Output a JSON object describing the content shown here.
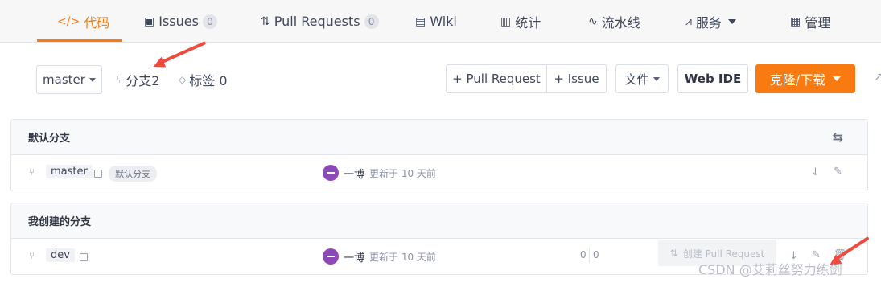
{
  "nav": {
    "tabs": [
      {
        "icon": "</>",
        "label": "代码",
        "active": true
      },
      {
        "icon": "▣",
        "label": "Issues",
        "count": "0"
      },
      {
        "icon": "⇅",
        "label": "Pull Requests",
        "count": "0"
      },
      {
        "icon": "▤",
        "label": "Wiki"
      },
      {
        "icon": "▥",
        "label": "统计"
      },
      {
        "icon": "∿",
        "label": "流水线"
      },
      {
        "icon": "⩘",
        "label": "服务"
      },
      {
        "icon": "▦",
        "label": "管理"
      }
    ]
  },
  "toolbar": {
    "branch_select": "master",
    "branch_count_label": "分支2",
    "tag_count_label": "标签 0",
    "pull_request_button": "+ Pull Request",
    "issue_button": "+ Issue",
    "file_button": "文件",
    "web_ide_button": "Web IDE",
    "clone_button": "克隆/下载"
  },
  "default_branch_panel": {
    "title": "默认分支",
    "row": {
      "branch": "master",
      "tag": "默认分支",
      "author": "一博",
      "updated": "更新于 10 天前"
    }
  },
  "my_branches_panel": {
    "title": "我创建的分支",
    "row": {
      "branch": "dev",
      "author": "一博",
      "updated": "更新于 10 天前",
      "behind": "0",
      "ahead": "0",
      "create_pr_button": "创建 Pull Request"
    }
  },
  "watermark": "CSDN @艾莉丝努力练剑",
  "colors": {
    "accent": "#fa7a12",
    "avatar": "#8e49b8",
    "arrow": "#f04a3e"
  }
}
